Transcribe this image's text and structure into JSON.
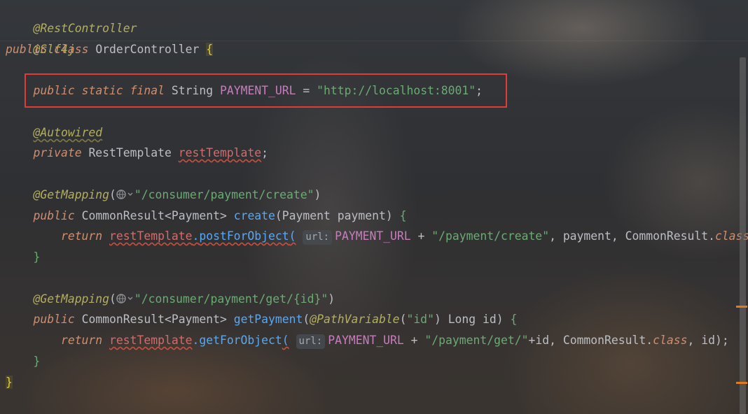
{
  "code": {
    "ann_rest_controller": "@RestController",
    "ann_slf4j": "@Slf4j",
    "kw_public": "public",
    "kw_class": "class",
    "class_name": "OrderController",
    "open_brace": "{",
    "close_brace": "}",
    "kw_static": "static",
    "kw_final": "final",
    "type_string": "String",
    "const_name": "PAYMENT_URL",
    "equals": "=",
    "url_value": "http://localhost:8001",
    "semicolon": ";",
    "ann_autowired": "@Autowired",
    "kw_private": "private",
    "type_rest_template": "RestTemplate",
    "field_rest_template": "restTemplate",
    "ann_get_mapping": "@GetMapping",
    "path_create": "/consumer/payment/create",
    "type_common_result": "CommonResult",
    "type_payment": "Payment",
    "method_create": "create",
    "param_payment": "payment",
    "kw_return": "return",
    "method_post_for_object": "postForObject",
    "hint_url": "url:",
    "str_payment_create": "/payment/create",
    "kw_class_literal": "class",
    "path_get": "/consumer/payment/get/{id}",
    "method_get_payment": "getPayment",
    "ann_path_variable": "@PathVariable",
    "str_id": "id",
    "type_long": "Long",
    "param_id": "id",
    "method_get_for_object": "getForObject",
    "str_payment_get": "/payment/get/"
  },
  "icons": {
    "globe": "globe-icon",
    "dropdown": "chevron-down-icon"
  },
  "colors": {
    "highlight_box": "#e03a3a",
    "keyword": "#cf8e6d",
    "annotation": "#b3ae60",
    "string": "#6aab73",
    "method": "#56a8f5",
    "field": "#c77dbb",
    "error_field": "#d66a6a",
    "marker": "#e07b1f"
  }
}
